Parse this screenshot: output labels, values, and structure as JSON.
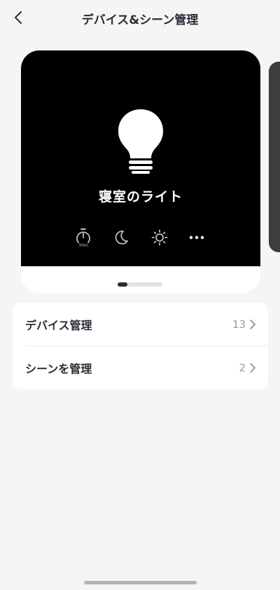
{
  "header": {
    "title": "デバイス&シーン管理",
    "back_icon": "chevron-left-icon"
  },
  "device_card": {
    "name": "寝室のライト",
    "icon": "light-bulb-icon",
    "actions": [
      {
        "icon": "timer-icon",
        "label": "30m"
      },
      {
        "icon": "moon-icon"
      },
      {
        "icon": "sun-icon"
      },
      {
        "icon": "more-icon"
      }
    ]
  },
  "pager": {
    "current": 1
  },
  "menu": {
    "items": [
      {
        "label": "デバイス管理",
        "count": "13"
      },
      {
        "label": "シーンを管理",
        "count": "2"
      }
    ]
  }
}
